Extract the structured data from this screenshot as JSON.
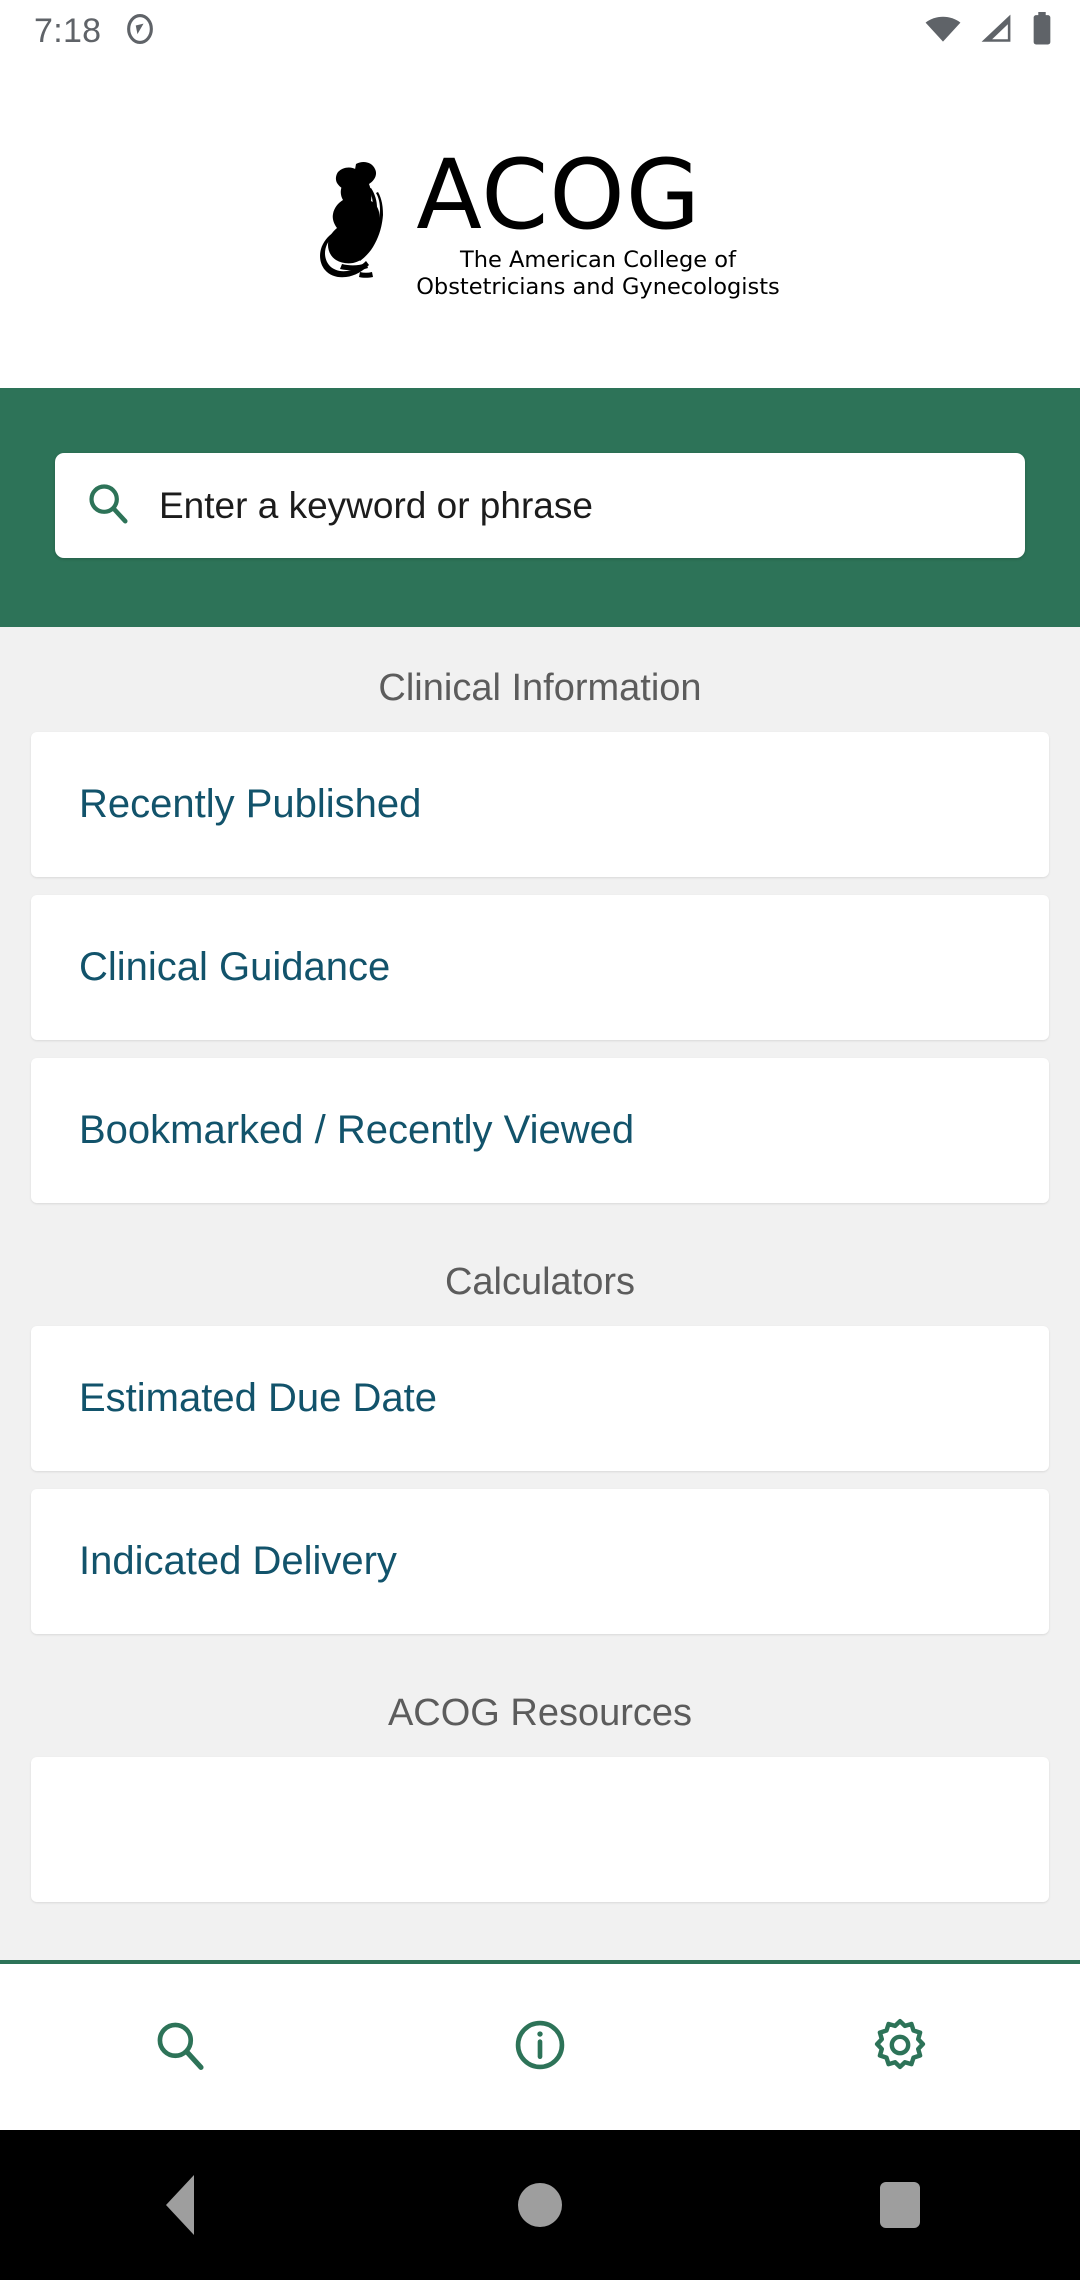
{
  "status_bar": {
    "time": "7:18",
    "icons": [
      "notification-sync-icon",
      "wifi-icon",
      "cellular-icon",
      "battery-icon"
    ]
  },
  "logo": {
    "wordmark": "ACOG",
    "tagline_line1": "The American College of",
    "tagline_line2": "Obstetricians and Gynecologists",
    "mark_name": "acog-figure-icon"
  },
  "search": {
    "placeholder": "Enter a keyword or phrase",
    "value": "",
    "icon": "search-icon"
  },
  "sections": [
    {
      "title": "Clinical Information",
      "items": [
        {
          "label": "Recently Published"
        },
        {
          "label": "Clinical Guidance"
        },
        {
          "label": "Bookmarked / Recently Viewed"
        }
      ]
    },
    {
      "title": "Calculators",
      "items": [
        {
          "label": "Estimated Due Date"
        },
        {
          "label": "Indicated Delivery"
        }
      ]
    },
    {
      "title": "ACOG Resources",
      "items": [
        {
          "label": ""
        }
      ]
    }
  ],
  "bottom_nav": [
    {
      "name": "search",
      "icon": "search-icon"
    },
    {
      "name": "info",
      "icon": "info-circle-icon"
    },
    {
      "name": "settings",
      "icon": "gear-icon"
    }
  ],
  "android_nav": [
    {
      "name": "back",
      "icon": "back-triangle-icon"
    },
    {
      "name": "home",
      "icon": "home-circle-icon"
    },
    {
      "name": "recents",
      "icon": "recents-square-icon"
    }
  ],
  "colors": {
    "brand_green": "#2d7358",
    "link_teal": "#12536b",
    "content_bg": "#f1f1f1",
    "section_title": "#5c5c5c"
  }
}
